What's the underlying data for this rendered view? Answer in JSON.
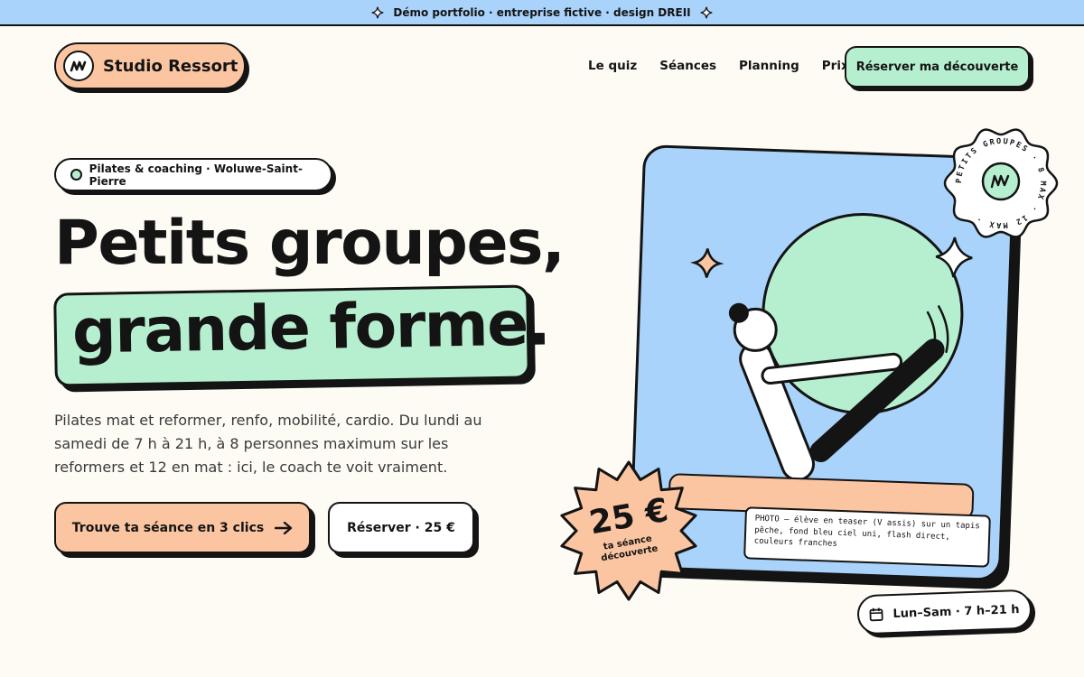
{
  "banner": {
    "text": "Démo portfolio · entreprise fictive · design DREII"
  },
  "brand": {
    "name": "Studio Ressort"
  },
  "nav": {
    "items": [
      "Le quiz",
      "Séances",
      "Planning",
      "Prix"
    ],
    "cta": "Réserver ma découverte"
  },
  "hero": {
    "tag": "Pilates & coaching · Woluwe-Saint-Pierre",
    "title_line1": "Petits groupes,",
    "title_line2": "grande forme.",
    "lead": "Pilates mat et reformer, renfo, mobilité, cardio. Du lundi au samedi de 7 h à 21 h, à 8 personnes maximum sur les reformers et 12 en mat : ici, le coach te voit vraiment.",
    "primary_cta": "Trouve ta séance en 3 clics",
    "secondary_cta": "Réserver · 25 €"
  },
  "visual": {
    "caption": "PHOTO — élève en teaser (V assis) sur un tapis pêche, fond bleu ciel uni, flash direct, couleurs franches",
    "price": "25 €",
    "price_sub_line1": "ta séance",
    "price_sub_line2": "découverte",
    "badge_text": "PETITS GROUPES · 8 MAX · 12 MAX ·",
    "hours": "Lun–Sam · 7 h–21 h"
  },
  "colors": {
    "peach": "#fbc5a2",
    "mint": "#b6efcf",
    "sky": "#a9d3fb",
    "ink": "#141414",
    "cream": "#fdfbf4"
  },
  "icons": [
    "sparkle-icon",
    "logo-mark-icon",
    "status-dot-icon",
    "arrow-right-icon",
    "calendar-icon"
  ]
}
